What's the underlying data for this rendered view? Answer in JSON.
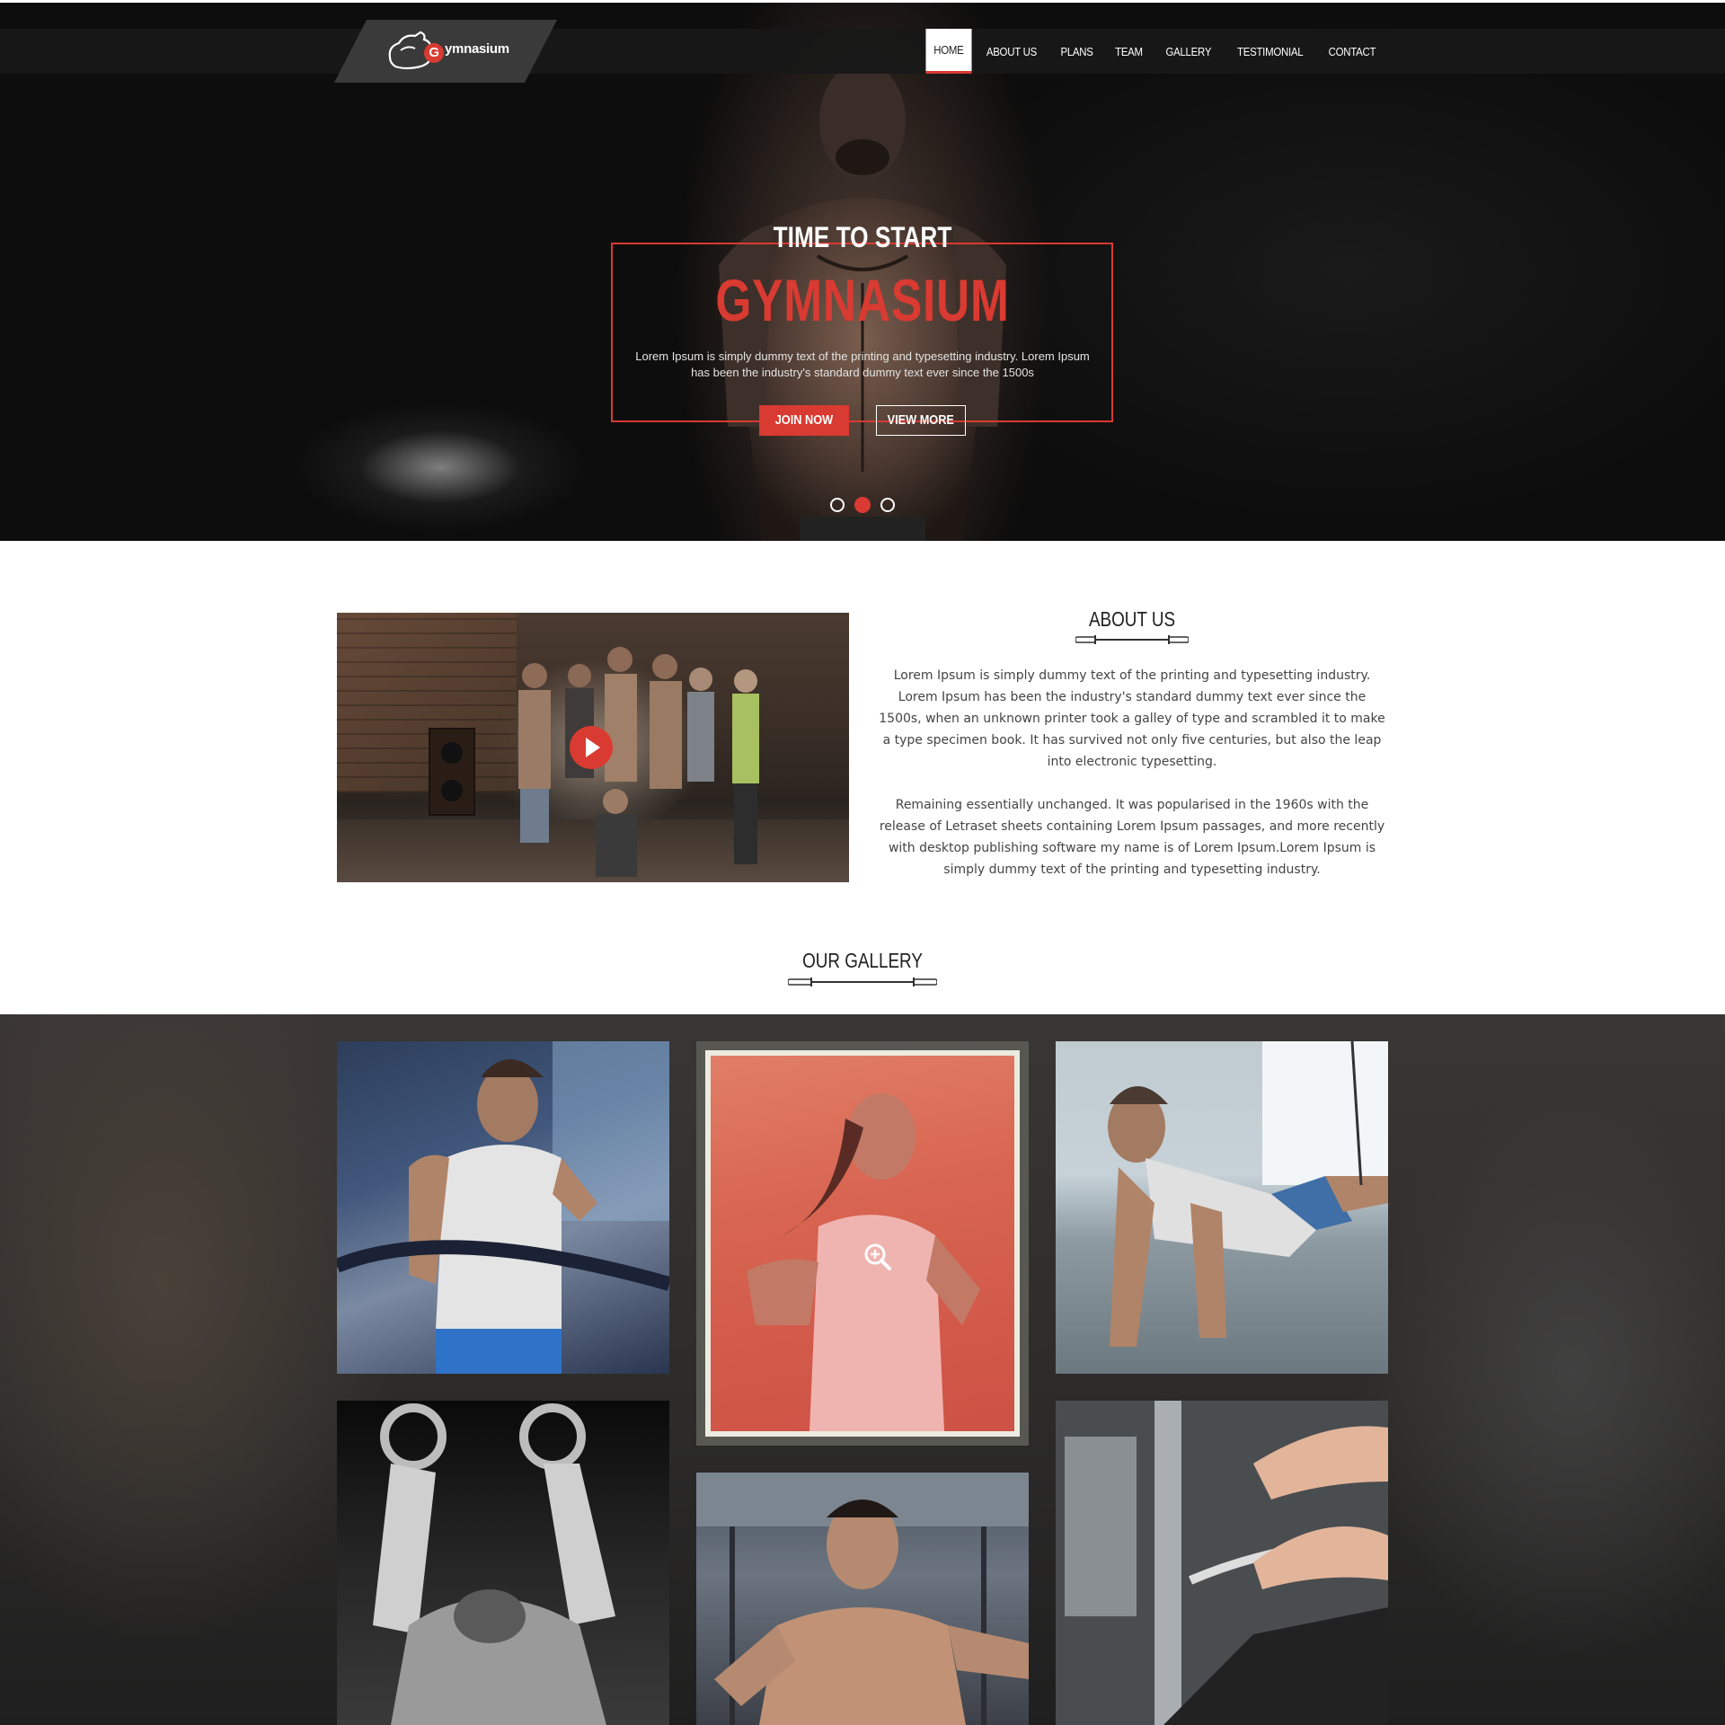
{
  "brand": {
    "logo_text": "ymnasium",
    "logo_initial": "G",
    "accent_color": "#d93a31"
  },
  "nav": {
    "items": [
      {
        "label": "HOME",
        "active": true
      },
      {
        "label": "ABOUT US",
        "active": false
      },
      {
        "label": "PLANS",
        "active": false
      },
      {
        "label": "TEAM",
        "active": false
      },
      {
        "label": "GALLERY",
        "active": false
      },
      {
        "label": "TESTIMONIAL",
        "active": false
      },
      {
        "label": "CONTACT",
        "active": false
      }
    ]
  },
  "hero": {
    "title": "TIME TO START",
    "brand": "GYMNASIUM",
    "description": "Lorem Ipsum is simply dummy text of the printing and typesetting industry. Lorem Ipsum has been the industry's standard dummy text ever since the 1500s",
    "join_label": "JOIN NOW",
    "view_label": "VIEW MORE",
    "slides": 3,
    "active_slide": 2
  },
  "about": {
    "title": "ABOUT US",
    "paragraph1": "Lorem Ipsum is simply dummy text of the printing and typesetting industry. Lorem Ipsum has been the industry's standard dummy text ever since the 1500s, when an unknown printer took a galley of type and scrambled it to make a type specimen book. It has survived not only five centuries, but also the leap into electronic typesetting.",
    "paragraph2": "Remaining essentially unchanged. It was popularised in the 1960s with the release of Letraset sheets containing Lorem Ipsum passages, and more recently with desktop publishing software my name is of Lorem Ipsum.Lorem Ipsum is simply dummy text of the printing and typesetting industry."
  },
  "gallery": {
    "title": "OUR GALLERY"
  }
}
